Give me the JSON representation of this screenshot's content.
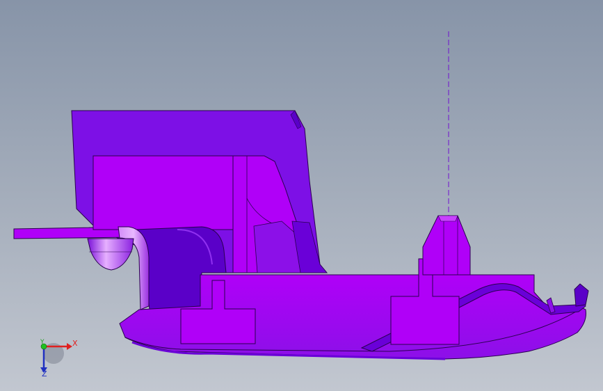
{
  "viewport": {
    "background_top": "#8794a8",
    "background_bottom": "#c2c7d0"
  },
  "model": {
    "color_primary": "#b000f8",
    "color_side": "#7d10e6",
    "color_shade": "#5a00c8",
    "edge_color": "#2a0050",
    "construction_axis": "dashed-vertical"
  },
  "triad": {
    "x_label": "X",
    "y_label": "Y",
    "z_label": "Z",
    "x_color": "#e02020",
    "y_color": "#20a020",
    "z_color": "#2030c0"
  }
}
